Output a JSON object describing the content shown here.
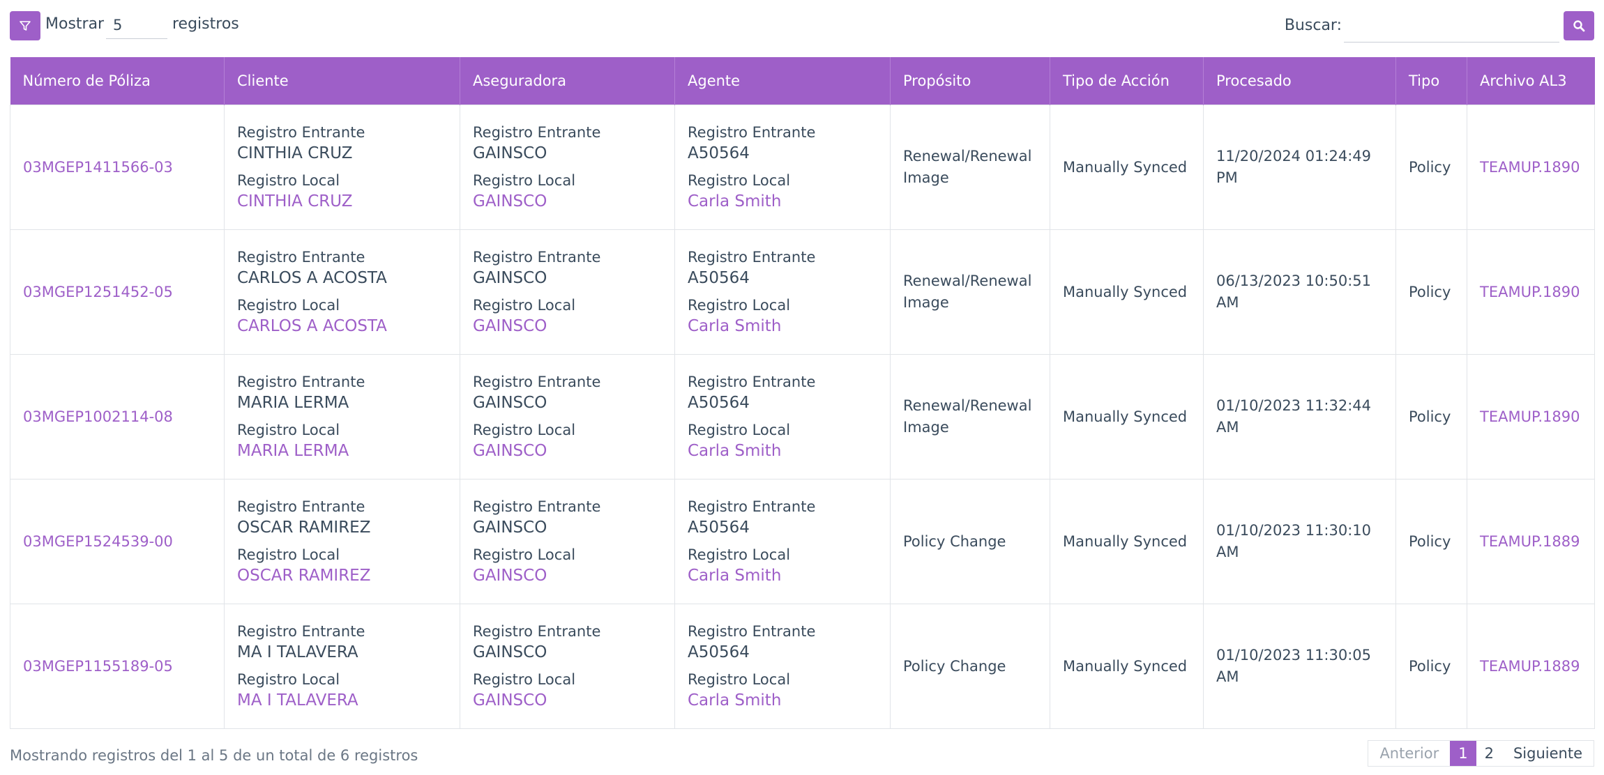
{
  "toolbar": {
    "show_label": "Mostrar",
    "show_value": "5",
    "records_label": "registros",
    "search_label": "Buscar:",
    "search_value": ""
  },
  "colors": {
    "accent": "#9e5fc8",
    "text": "#3a4b5c",
    "border": "#e1e4e8"
  },
  "icons": {
    "filter": "filter-icon",
    "search": "search-icon"
  },
  "table": {
    "headers": [
      "Número de Póliza",
      "Cliente",
      "Aseguradora",
      "Agente",
      "Propósito",
      "Tipo de Acción",
      "Procesado",
      "Tipo",
      "Archivo AL3"
    ],
    "incoming_label": "Registro Entrante",
    "local_label": "Registro Local",
    "rows": [
      {
        "policy": "03MGEP1411566-03",
        "client_in": "CINTHIA CRUZ",
        "client_local": "CINTHIA CRUZ",
        "insurer_in": "GAINSCO",
        "insurer_local": "GAINSCO",
        "agent_in": "A50564",
        "agent_local": "Carla Smith",
        "purpose": "Renewal/Renewal Image",
        "action": "Manually Synced",
        "processed": "11/20/2024 01:24:49 PM",
        "type": "Policy",
        "file": "TEAMUP.1890"
      },
      {
        "policy": "03MGEP1251452-05",
        "client_in": "CARLOS A ACOSTA",
        "client_local": "CARLOS A ACOSTA",
        "insurer_in": "GAINSCO",
        "insurer_local": "GAINSCO",
        "agent_in": "A50564",
        "agent_local": "Carla Smith",
        "purpose": "Renewal/Renewal Image",
        "action": "Manually Synced",
        "processed": "06/13/2023 10:50:51 AM",
        "type": "Policy",
        "file": "TEAMUP.1890"
      },
      {
        "policy": "03MGEP1002114-08",
        "client_in": "MARIA LERMA",
        "client_local": "MARIA LERMA",
        "insurer_in": "GAINSCO",
        "insurer_local": "GAINSCO",
        "agent_in": "A50564",
        "agent_local": "Carla Smith",
        "purpose": "Renewal/Renewal Image",
        "action": "Manually Synced",
        "processed": "01/10/2023 11:32:44 AM",
        "type": "Policy",
        "file": "TEAMUP.1890"
      },
      {
        "policy": "03MGEP1524539-00",
        "client_in": "OSCAR RAMIREZ",
        "client_local": "OSCAR RAMIREZ",
        "insurer_in": "GAINSCO",
        "insurer_local": "GAINSCO",
        "agent_in": "A50564",
        "agent_local": "Carla Smith",
        "purpose": "Policy Change",
        "action": "Manually Synced",
        "processed": "01/10/2023 11:30:10 AM",
        "type": "Policy",
        "file": "TEAMUP.1889"
      },
      {
        "policy": "03MGEP1155189-05",
        "client_in": "MA I TALAVERA",
        "client_local": "MA I TALAVERA",
        "insurer_in": "GAINSCO",
        "insurer_local": "GAINSCO",
        "agent_in": "A50564",
        "agent_local": "Carla Smith",
        "purpose": "Policy Change",
        "action": "Manually Synced",
        "processed": "01/10/2023 11:30:05 AM",
        "type": "Policy",
        "file": "TEAMUP.1889"
      }
    ]
  },
  "footer": {
    "info": "Mostrando registros del 1 al 5 de un total de 6 registros",
    "prev": "Anterior",
    "pages": [
      "1",
      "2"
    ],
    "current_page": "1",
    "next": "Siguiente"
  }
}
